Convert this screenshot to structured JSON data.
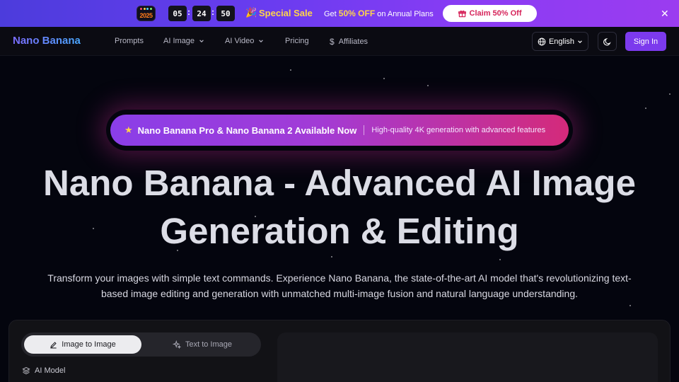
{
  "promo": {
    "badge": "2025",
    "timer": {
      "hours": "05",
      "minutes": "24",
      "seconds": "50",
      "separator": ":"
    },
    "sale_label": "Special Sale",
    "offer_prefix": "Get",
    "offer_highlight": "50% OFF",
    "offer_suffix": "on Annual Plans",
    "claim_label": "Claim 50% Off",
    "accent_color": "#7c3aed"
  },
  "nav": {
    "logo": "Nano Banana",
    "items": [
      {
        "label": "Prompts",
        "has_dropdown": false
      },
      {
        "label": "AI Image",
        "has_dropdown": true
      },
      {
        "label": "AI Video",
        "has_dropdown": true
      },
      {
        "label": "Pricing",
        "has_dropdown": false
      },
      {
        "label": "Affiliates",
        "has_dropdown": false,
        "icon": "dollar-icon"
      }
    ],
    "language": "English",
    "signin_label": "Sign In"
  },
  "hero": {
    "announcement": "Nano Banana Pro & Nano Banana 2 Available Now",
    "announcement_sub": "High-quality 4K generation with advanced features",
    "title_line1": "Nano Banana - Advanced AI Image",
    "title_line2": "Generation & Editing",
    "subtitle": "Transform your images with simple text commands. Experience Nano Banana, the state-of-the-art AI model that's revolutionizing text-based image editing and generation with unmatched multi-image fusion and natural language understanding."
  },
  "editor": {
    "tabs": [
      {
        "label": "Image to Image",
        "active": true
      },
      {
        "label": "Text to Image",
        "active": false
      }
    ],
    "model_label": "AI Model"
  }
}
